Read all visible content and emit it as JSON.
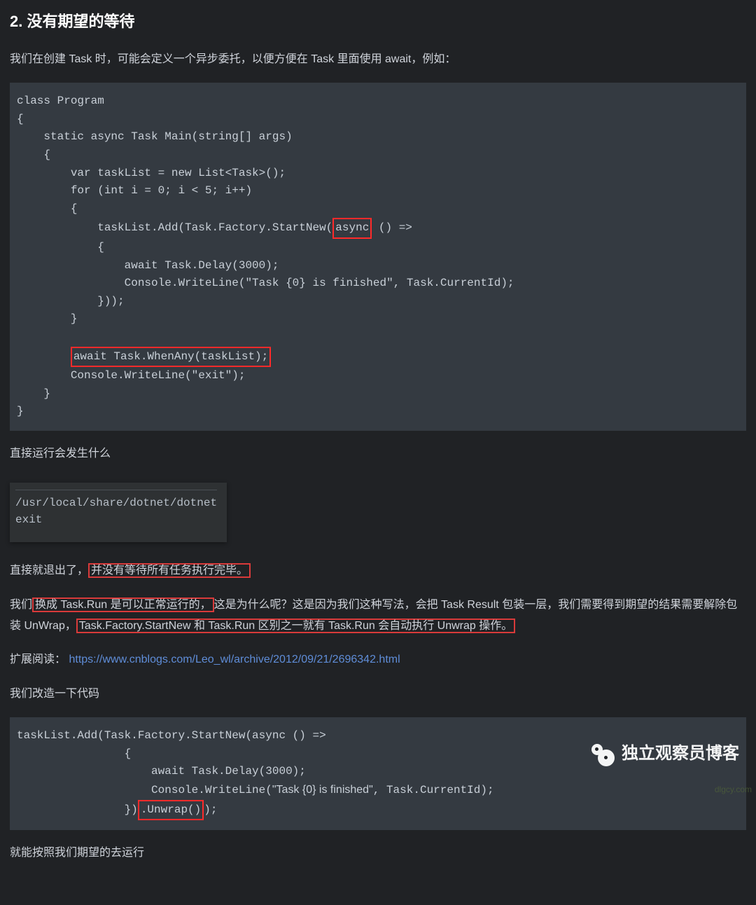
{
  "heading": "2. 没有期望的等待",
  "intro": "我们在创建 Task 时，可能会定义一个异步委托，以便方便在 Task 里面使用 await，例如：",
  "code1": {
    "l1": "class Program",
    "l2": "{",
    "l3": "    static async Task Main(string[] args)",
    "l4": "    {",
    "l5": "        var taskList = new List<Task>();",
    "l6": "        for (int i = 0; i < 5; i++)",
    "l7": "        {",
    "l8a": "            taskList.Add(Task.Factory.StartNew(",
    "l8b": "async",
    "l8c": " () =>",
    "l9": "            {",
    "l10": "                await Task.Delay(3000);",
    "l11": "                Console.WriteLine(\"Task {0} is finished\", Task.CurrentId);",
    "l12": "            }));",
    "l13": "        }",
    "l14": "",
    "l15a": "        ",
    "l15b": "await Task.WhenAny(taskList);",
    "l16": "        Console.WriteLine(\"exit\");",
    "l17": "    }",
    "l18": "}"
  },
  "para2": "直接运行会发生什么",
  "terminal": {
    "line1": "/usr/local/share/dotnet/dotnet",
    "line2": "exit"
  },
  "para3a": "直接就退出了，",
  "para3b": "并没有等待所有任务执行完毕。",
  "para4a": "我们",
  "para4b": "换成 Task.Run 是可以正常运行的，",
  "para4c": "这是为什么呢？这是因为我们这种写法，会把 Task Result 包装一层，我们需要得到期望的结果需要解除包装 UnWrap，",
  "para4d": "Task.Factory.StartNew 和 Task.Run 区别之一就有 Task.Run 会自动执行 Unwrap 操作。",
  "para5label": "扩展阅读：",
  "para5link": "https://www.cnblogs.com/Leo_wl/archive/2012/09/21/2696342.html",
  "para6": "我们改造一下代码",
  "code2": {
    "l1": "taskList.Add(Task.Factory.StartNew(async () =>",
    "l2": "                {",
    "l3": "                    await Task.Delay(3000);",
    "l4a": "                    Console.WriteLine(",
    "l4b": "\"Task {0} is finished\"",
    "l4c": ", Task.CurrentId);",
    "l5a": "                })",
    "l5b": ".Unwrap()",
    "l5c": ");"
  },
  "para7": "就能按照我们期望的去运行",
  "watermark": "独立观察员博客",
  "corner": "dlgcy.com"
}
